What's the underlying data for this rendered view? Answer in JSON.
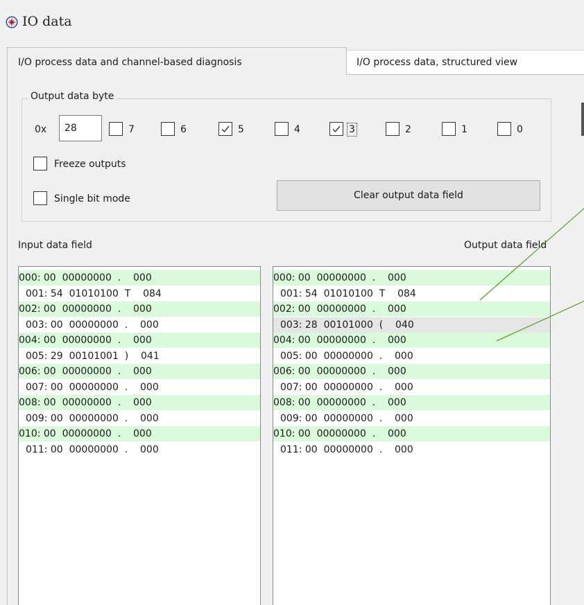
{
  "window": {
    "title": "IO data"
  },
  "tabs": [
    {
      "label": "I/O process data and channel-based diagnosis",
      "active": true
    },
    {
      "label": "I/O process data, structured view",
      "active": false
    }
  ],
  "output_byte": {
    "group_label": "Output data byte",
    "hex_prefix": "0x",
    "hex_value": "28",
    "bits": [
      {
        "label": "7",
        "checked": false
      },
      {
        "label": "6",
        "checked": false
      },
      {
        "label": "5",
        "checked": true
      },
      {
        "label": "4",
        "checked": false
      },
      {
        "label": "3",
        "checked": true,
        "focused": true
      },
      {
        "label": "2",
        "checked": false
      },
      {
        "label": "1",
        "checked": false
      },
      {
        "label": "0",
        "checked": false
      }
    ],
    "freeze_outputs": {
      "label": "Freeze outputs",
      "checked": false
    },
    "single_bit_mode": {
      "label": "Single bit mode",
      "checked": false
    },
    "clear_button": "Clear output data field"
  },
  "input_field": {
    "label": "Input data field",
    "rows": [
      "000: 00  00000000  .    000",
      "001: 54  01010100  T    084",
      "002: 00  00000000  .    000",
      "003: 00  00000000  .    000",
      "004: 00  00000000  .    000",
      "005: 29  00101001  )    041",
      "006: 00  00000000  .    000",
      "007: 00  00000000  .    000",
      "008: 00  00000000  .    000",
      "009: 00  00000000  .    000",
      "010: 00  00000000  .    000",
      "011: 00  00000000  .    000"
    ]
  },
  "output_field": {
    "label": "Output data field",
    "selected_row": 3,
    "rows": [
      "000: 00  00000000  .    000",
      "001: 54  01010100  T    084",
      "002: 00  00000000  .    000",
      "003: 28  00101000  (    040",
      "004: 00  00000000  .    000",
      "005: 00  00000000  .    000",
      "006: 00  00000000  .    000",
      "007: 00  00000000  .    000",
      "008: 00  00000000  .    000",
      "009: 00  00000000  .    000",
      "010: 00  00000000  .    000",
      "011: 00  00000000  .    000"
    ]
  },
  "colors": {
    "row_highlight": "#dbf9db",
    "selected_row": "#e5e5e5",
    "annotation_line": "#5aa02c",
    "app_icon_red": "#e02020",
    "app_icon_blue": "#1f4e9e"
  }
}
